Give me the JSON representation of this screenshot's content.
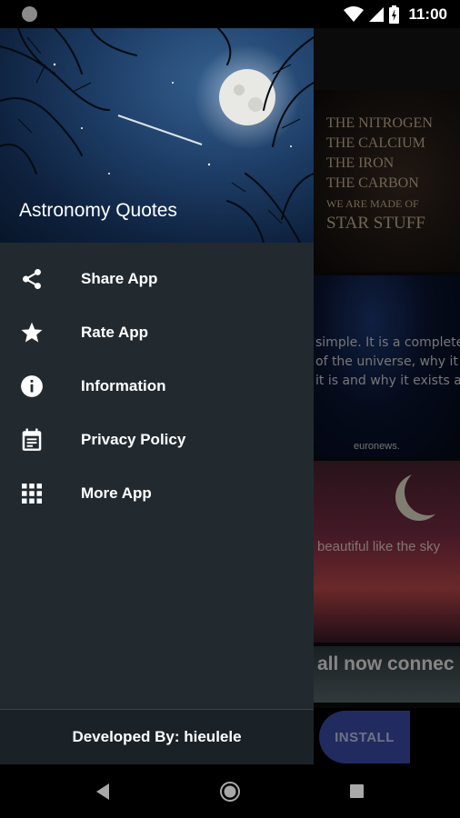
{
  "status_bar": {
    "time": "11:00",
    "icons": [
      "notification-dot-icon",
      "wifi-icon",
      "signal-icon",
      "battery-icon"
    ]
  },
  "drawer": {
    "title": "Astronomy Quotes",
    "menu": [
      {
        "label": "Share App",
        "icon": "share-icon"
      },
      {
        "label": "Rate App",
        "icon": "star-icon"
      },
      {
        "label": "Information",
        "icon": "info-icon"
      },
      {
        "label": "Privacy Policy",
        "icon": "calendar-document-icon"
      },
      {
        "label": "More App",
        "icon": "grid-icon"
      }
    ],
    "footer": "Developed By: hieulele"
  },
  "background": {
    "quote_card_lines": [
      "THE NITROGEN",
      "THE CALCIUM",
      "THE IRON",
      "THE CARBON",
      "WE ARE MADE OF",
      "STAR STUFF"
    ],
    "galaxy_card_lines": [
      "simple. It is a complete und",
      "of the universe, why it is",
      "it is and why it exists at al"
    ],
    "galaxy_card_logo": "euronews.",
    "sky_card_text": "beautiful like the sky",
    "ad_text": "all now connec",
    "install_label": "INSTALL"
  },
  "colors": {
    "drawer_bg": "#222a30",
    "footer_bg": "#1b2227",
    "install_button": "#3d4fb0"
  }
}
